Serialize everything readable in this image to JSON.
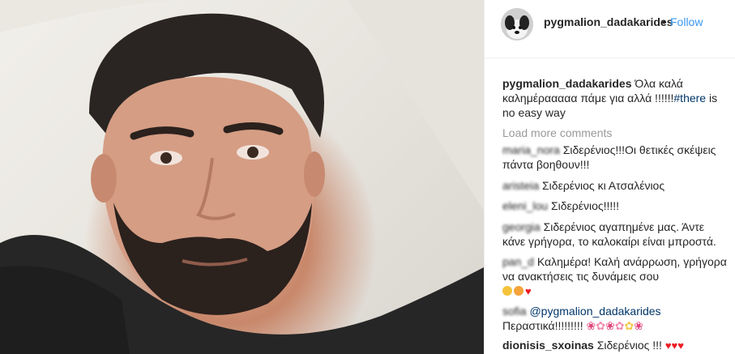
{
  "header": {
    "username": "pygmalion_dadakarides",
    "separator": "•",
    "follow_label": "Follow"
  },
  "caption": {
    "username": "pygmalion_dadakarides",
    "text": "Όλα καλά καλημέρααααα πάμε για αλλά !!!!!!",
    "hashtag": "#there",
    "text_after": "is no easy way"
  },
  "load_more_label": "Load more comments",
  "comments": [
    {
      "username": "maria_nora",
      "text": "Σιδερένιος!!!Οι θετικές σκέψεις πάντα βοηθουν!!!"
    },
    {
      "username": "aristeia",
      "text": "Σιδερένιος κι Ατσαλένιος"
    },
    {
      "username": "eleni_lou",
      "text": "Σιδερένιος!!!!!"
    },
    {
      "username": "georgia",
      "text": "Σιδερένιος αγαπημένε μας. Άντε κάνε γρήγορα, το καλοκαίρι είναι μπροστά."
    },
    {
      "username": "pan_d",
      "text": "Καλημέρα! Καλή ανάρρωση, γρήγορα να ανακτήσεις τις δυνάμεις σου"
    },
    {
      "username": "sofia",
      "mention": "@pygmalion_dadakarides",
      "text": "Περαστικά!!!!!!!!!"
    },
    {
      "username": "dionisis_sxoinas",
      "text": "Σιδερένιος !!!"
    }
  ],
  "colors": {
    "link": "#3897f0",
    "text": "#262626",
    "muted": "#999999",
    "hashtag": "#003569",
    "heart": "#ed1c24"
  },
  "icons": {
    "emoji_smile": "smiling-face-icon",
    "emoji_kiss": "kissing-face-icon",
    "emoji_heart": "red-heart-icon",
    "emoji_tulip": "tulip-icon",
    "emoji_blossom": "cherry-blossom-icon"
  }
}
